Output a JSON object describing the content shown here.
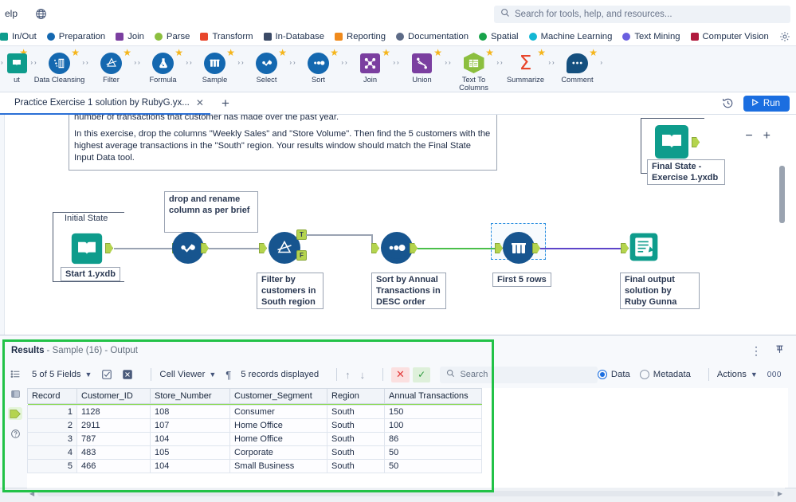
{
  "menu": {
    "items": [
      "elp"
    ],
    "globe_icon": "globe-icon"
  },
  "search": {
    "placeholder": "Search for tools, help, and resources...",
    "icon": "search-icon"
  },
  "categories": [
    {
      "label": "In/Out",
      "color": "#0e9c8c",
      "shape": "sq"
    },
    {
      "label": "Preparation",
      "color": "#1468b0",
      "shape": "dot"
    },
    {
      "label": "Join",
      "color": "#7b3fa0",
      "shape": "sq"
    },
    {
      "label": "Parse",
      "color": "#8cbf3f",
      "shape": "dot"
    },
    {
      "label": "Transform",
      "color": "#e8462c",
      "shape": "sq"
    },
    {
      "label": "In-Database",
      "color": "#3b4a66",
      "shape": "sq"
    },
    {
      "label": "Reporting",
      "color": "#f08a1c",
      "shape": "sq"
    },
    {
      "label": "Documentation",
      "color": "#5d6b87",
      "shape": "dot"
    },
    {
      "label": "Spatial",
      "color": "#18a34a",
      "shape": "dot"
    },
    {
      "label": "Machine Learning",
      "color": "#13b7d4",
      "shape": "dot"
    },
    {
      "label": "Text Mining",
      "color": "#6a5fe0",
      "shape": "dot"
    },
    {
      "label": "Computer Vision",
      "color": "#b01a3d",
      "shape": "sq"
    }
  ],
  "catbar_controls": {
    "gear_icon": "gear-icon",
    "overflow_icon": "chevron-right-icon"
  },
  "tools": [
    {
      "label": "ut",
      "icon": "input-output-icon",
      "color": "#0e9c8c",
      "favorite": true,
      "partial": true
    },
    {
      "label": "Data Cleansing",
      "icon": "data-cleansing-icon",
      "color": "#1468b0",
      "favorite": true
    },
    {
      "label": "Filter",
      "icon": "filter-icon",
      "color": "#1468b0",
      "favorite": true
    },
    {
      "label": "Formula",
      "icon": "formula-icon",
      "color": "#1468b0",
      "favorite": true
    },
    {
      "label": "Sample",
      "icon": "sample-icon",
      "color": "#1468b0",
      "favorite": true
    },
    {
      "label": "Select",
      "icon": "select-icon",
      "color": "#1468b0",
      "favorite": true
    },
    {
      "label": "Sort",
      "icon": "sort-icon",
      "color": "#1468b0",
      "favorite": true
    },
    {
      "label": "Join",
      "icon": "join-icon",
      "color": "#7b3fa0",
      "favorite": true
    },
    {
      "label": "Union",
      "icon": "union-icon",
      "color": "#7b3fa0",
      "favorite": true
    },
    {
      "label": "Text To Columns",
      "icon": "text-to-columns-icon",
      "color": "#8cbf3f",
      "favorite": true
    },
    {
      "label": "Summarize",
      "icon": "summarize-icon",
      "color": "#e8462c",
      "favorite": true
    },
    {
      "label": "Comment",
      "icon": "comment-icon",
      "color": "#15507f",
      "favorite": true
    }
  ],
  "tabbar": {
    "tab_title": "Practice Exercise 1 solution by RubyG.yx...",
    "close_icon": "close-icon",
    "new_tab_icon": "plus-icon",
    "history_icon": "history-icon",
    "run_label": "Run",
    "run_icon": "play-icon"
  },
  "canvas": {
    "comment_box": {
      "line_top": "number of transactions that customer has made over the past year.",
      "body": "In this exercise, drop the columns \"Weekly Sales\" and \"Store Volume\". Then find the 5 customers with the highest average transactions in the \"South\" region. Your results window should match the Final State Input Data tool."
    },
    "notes": [
      {
        "name": "note-drop-rename",
        "text": "drop and rename column as per brief"
      }
    ],
    "nodes": [
      {
        "name": "node-initial-state",
        "top_label": "Initial State",
        "bottom_label": "Start 1.yxdb",
        "icon": "input-data-icon"
      },
      {
        "name": "node-select",
        "bottom_label": "",
        "icon": "select-icon"
      },
      {
        "name": "node-filter",
        "bottom_label": "Filter by customers in South region",
        "icon": "filter-icon",
        "port_true": "T",
        "port_false": "F"
      },
      {
        "name": "node-sort",
        "bottom_label": "Sort by Annual Transactions in DESC order",
        "icon": "sort-icon"
      },
      {
        "name": "node-sample",
        "bottom_label": "First 5 rows",
        "icon": "sample-icon",
        "selected": true
      },
      {
        "name": "node-final-state",
        "bottom_label": "Final State - Exercise 1.yxdb",
        "icon": "input-data-icon"
      },
      {
        "name": "node-output",
        "bottom_label": "Final output solution by Ruby Gunna",
        "icon": "browse-icon"
      }
    ],
    "zoom_controls": {
      "zoom_out": "minus-icon",
      "zoom_in": "plus-icon"
    }
  },
  "results": {
    "title": "Results",
    "subtitle": "- Sample (16) - Output",
    "more_icon": "kebab-menu-icon",
    "pin_icon": "pin-icon",
    "rail": [
      {
        "name": "rail-list-icon",
        "icon": "list-icon"
      },
      {
        "name": "rail-panel-icon",
        "icon": "panel-icon"
      },
      {
        "name": "rail-output-anchor-icon",
        "icon": "anchor-icon",
        "active": true
      },
      {
        "name": "rail-help-icon",
        "icon": "help-icon"
      }
    ],
    "toolbar": {
      "fields_label": "5 of 5 Fields",
      "check_all_icon": "check-square-icon",
      "uncheck_all_icon": "x-square-icon",
      "viewer_label": "Cell Viewer",
      "pilcrow_icon": "pilcrow-icon",
      "records_label": "5 records displayed",
      "up_icon": "arrow-up-icon",
      "down_icon": "arrow-down-icon",
      "error_icon": "x-icon",
      "ok_icon": "check-icon",
      "search_placeholder": "Search",
      "search_icon": "search-icon",
      "data_label": "Data",
      "metadata_label": "Metadata",
      "data_selected": true,
      "actions_label": "Actions",
      "counter": "000"
    },
    "table": {
      "columns": [
        "Record",
        "Customer_ID",
        "Store_Number",
        "Customer_Segment",
        "Region",
        "Annual Transactions"
      ],
      "rows": [
        [
          "1",
          "1128",
          "108",
          "Consumer",
          "South",
          "150"
        ],
        [
          "2",
          "2911",
          "107",
          "Home Office",
          "South",
          "100"
        ],
        [
          "3",
          "787",
          "104",
          "Home Office",
          "South",
          "86"
        ],
        [
          "4",
          "483",
          "105",
          "Corporate",
          "South",
          "50"
        ],
        [
          "5",
          "466",
          "104",
          "Small Business",
          "South",
          "50"
        ]
      ]
    }
  },
  "colors": {
    "accent_blue": "#1b6ee0",
    "highlight_green": "#22c247",
    "node_blue": "#17558f",
    "teal": "#0e9c8c"
  }
}
